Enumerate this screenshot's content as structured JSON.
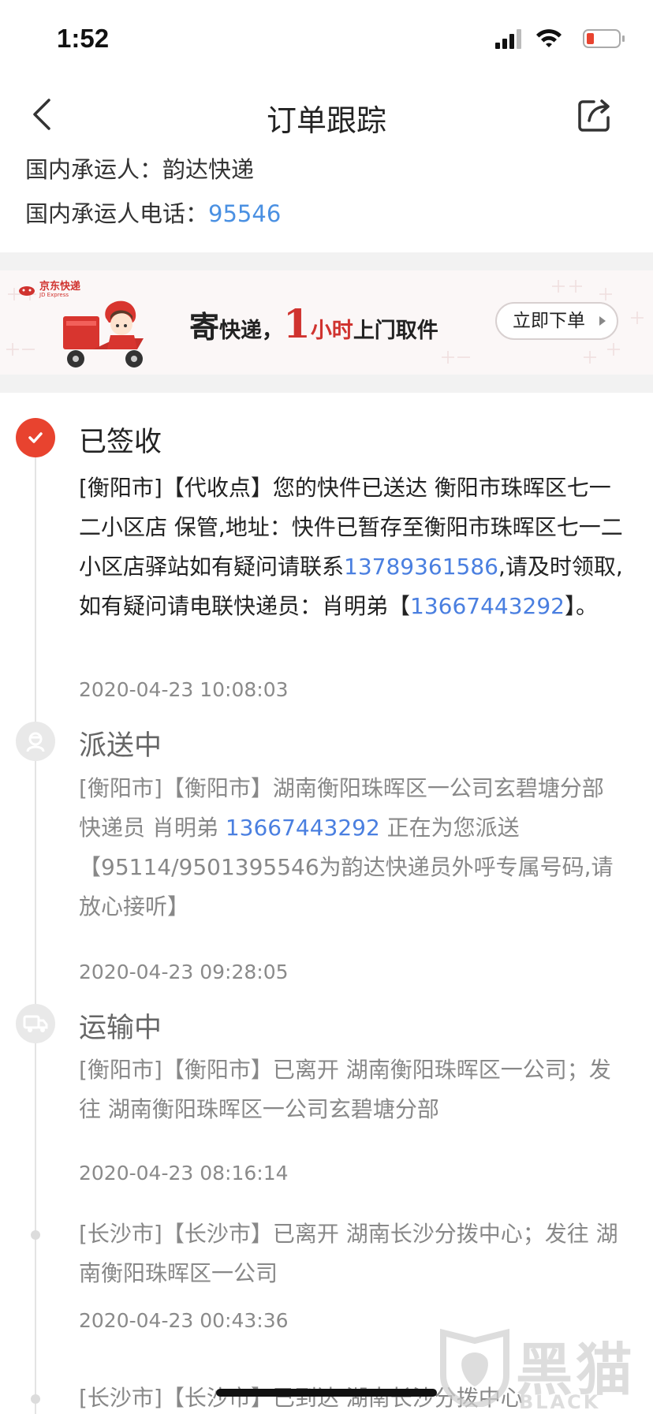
{
  "status_bar": {
    "time": "1:52"
  },
  "nav": {
    "title": "订单跟踪"
  },
  "carrier": {
    "name_label": "国内承运人：韵达快递",
    "phone_label": "国内承运人电话：",
    "phone": "95546"
  },
  "banner": {
    "brand": "京东快递",
    "brand_sub": "JD Express",
    "slogan_1": "寄",
    "slogan_2": "快递，",
    "slogan_3": "1",
    "slogan_4": "小时",
    "slogan_5": "上门取件",
    "cta": "立即下单"
  },
  "tracking": [
    {
      "status": "已签收",
      "desc_parts": [
        {
          "text": "[衡阳市]【代收点】您的快件已送达 衡阳市珠晖区七一二小区店 保管,地址：快件已暂存至衡阳市珠晖区七一二小区店驿站如有疑问请联系"
        },
        {
          "text": "13789361586",
          "link": true
        },
        {
          "text": ",请及时领取,如有疑问请电联快递员：肖明弟【"
        },
        {
          "text": "13667443292",
          "link": true
        },
        {
          "text": "】。"
        }
      ],
      "time": "2020-04-23 10:08:03"
    },
    {
      "status": "派送中",
      "desc_parts": [
        {
          "text": "[衡阳市]【衡阳市】湖南衡阳珠晖区一公司玄碧塘分部 快递员 肖明弟 "
        },
        {
          "text": "13667443292",
          "link": true
        },
        {
          "text": " 正在为您派送【95114/9501395546为韵达快递员外呼专属号码,请放心接听】"
        }
      ],
      "time": "2020-04-23 09:28:05"
    },
    {
      "status": "运输中",
      "desc_parts": [
        {
          "text": "[衡阳市]【衡阳市】已离开 湖南衡阳珠晖区一公司；发往 湖南衡阳珠晖区一公司玄碧塘分部"
        }
      ],
      "time": "2020-04-23 08:16:14"
    },
    {
      "status": "",
      "desc_parts": [
        {
          "text": "[长沙市]【长沙市】已离开 湖南长沙分拨中心；发往 湖南衡阳珠晖区一公司"
        }
      ],
      "time": "2020-04-23 00:43:36"
    },
    {
      "status": "",
      "desc_parts": [
        {
          "text": "[长沙市]【长沙市】已到达 湖南长沙分拨中心"
        }
      ],
      "time": ""
    }
  ],
  "watermark": {
    "text": "黑猫",
    "sub": "BLACK CAT"
  }
}
